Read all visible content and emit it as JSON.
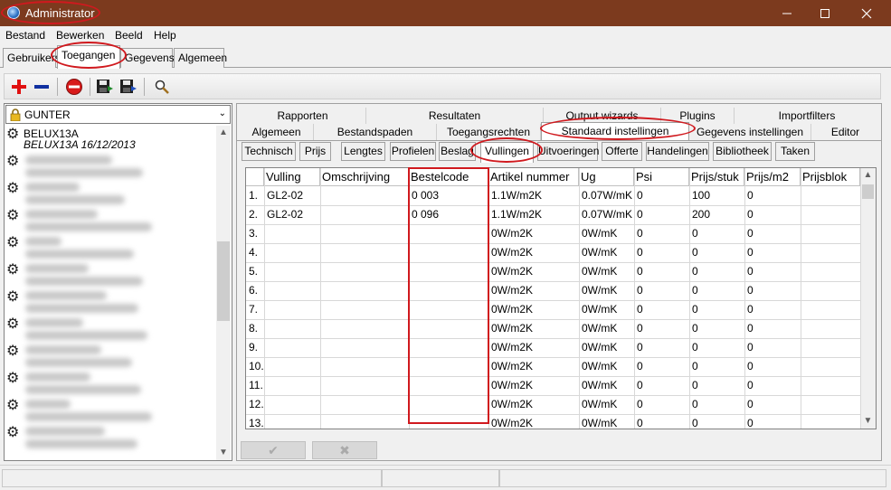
{
  "window": {
    "title": "Administrator"
  },
  "menu": [
    "Bestand",
    "Bewerken",
    "Beeld",
    "Help"
  ],
  "top_tabs": [
    "Gebruikers",
    "Toegangen",
    "Gegevens",
    "Algemeen"
  ],
  "user_select": {
    "value": "GUNTER"
  },
  "users": [
    {
      "name": "BELUX13A",
      "sub": "BELUX13A 16/12/2013"
    }
  ],
  "tabs_row1": [
    "Rapporten",
    "Resultaten",
    "Output wizards",
    "Plugins",
    "Importfilters"
  ],
  "tabs_row2": [
    "Algemeen",
    "Bestandspaden",
    "Toegangsrechten",
    "Standaard instellingen",
    "Gegevens instellingen",
    "Editor"
  ],
  "sub_tabs": [
    "Technisch",
    "Prijs",
    "Lengtes",
    "Profielen",
    "Beslag",
    "Vullingen",
    "Uitvoeringen",
    "Offerte",
    "Handelingen",
    "Bibliotheek",
    "Taken"
  ],
  "grid": {
    "columns": [
      "Vulling",
      "Omschrijving",
      "Bestelcode",
      "Artikel nummer",
      "Ug",
      "Psi",
      "Prijs/stuk",
      "Prijs/m2",
      "Prijsblok"
    ],
    "rows": [
      [
        "1.",
        "GL2-02",
        "",
        "0 003",
        "",
        "1.1W/m2K",
        "0.07W/mK",
        "0",
        "100",
        "0"
      ],
      [
        "2.",
        "GL2-02",
        "",
        "0 096",
        "",
        "1.1W/m2K",
        "0.07W/mK",
        "0",
        "200",
        "0"
      ],
      [
        "3.",
        "",
        "",
        "",
        "",
        "0W/m2K",
        "0W/mK",
        "0",
        "0",
        "0"
      ],
      [
        "4.",
        "",
        "",
        "",
        "",
        "0W/m2K",
        "0W/mK",
        "0",
        "0",
        "0"
      ],
      [
        "5.",
        "",
        "",
        "",
        "",
        "0W/m2K",
        "0W/mK",
        "0",
        "0",
        "0"
      ],
      [
        "6.",
        "",
        "",
        "",
        "",
        "0W/m2K",
        "0W/mK",
        "0",
        "0",
        "0"
      ],
      [
        "7.",
        "",
        "",
        "",
        "",
        "0W/m2K",
        "0W/mK",
        "0",
        "0",
        "0"
      ],
      [
        "8.",
        "",
        "",
        "",
        "",
        "0W/m2K",
        "0W/mK",
        "0",
        "0",
        "0"
      ],
      [
        "9.",
        "",
        "",
        "",
        "",
        "0W/m2K",
        "0W/mK",
        "0",
        "0",
        "0"
      ],
      [
        "10.",
        "",
        "",
        "",
        "",
        "0W/m2K",
        "0W/mK",
        "0",
        "0",
        "0"
      ],
      [
        "11.",
        "",
        "",
        "",
        "",
        "0W/m2K",
        "0W/mK",
        "0",
        "0",
        "0"
      ],
      [
        "12.",
        "",
        "",
        "",
        "",
        "0W/m2K",
        "0W/mK",
        "0",
        "0",
        "0"
      ],
      [
        "13.",
        "",
        "",
        "",
        "",
        "0W/m2K",
        "0W/mK",
        "0",
        "0",
        "0"
      ]
    ]
  },
  "buttons": {
    "ok": "✔",
    "cancel": "✖"
  },
  "colors": {
    "titlebar": "#7c3a1e",
    "annotation": "#d0191e"
  },
  "icons": [
    "app-icon",
    "add-icon",
    "remove-icon",
    "delete-icon",
    "save-icon",
    "save-as-icon",
    "search-icon",
    "lock-icon",
    "gear-icon"
  ]
}
